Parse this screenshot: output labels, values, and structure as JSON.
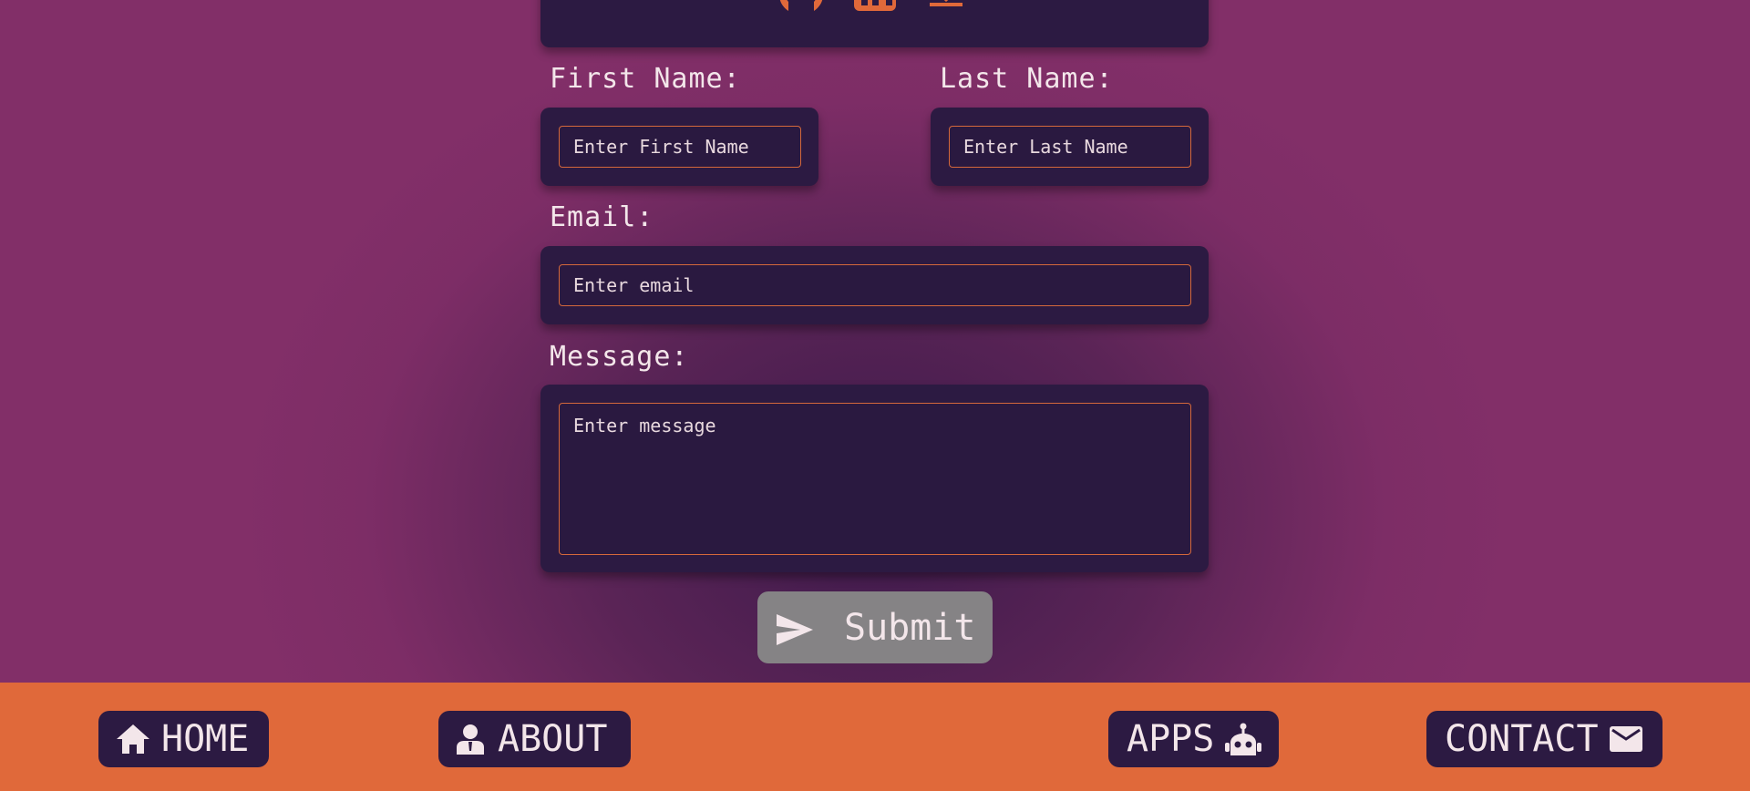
{
  "top_icons": [
    {
      "icon": "github-icon"
    },
    {
      "icon": "linkedin-icon"
    },
    {
      "icon": "download-icon"
    }
  ],
  "form": {
    "first_name": {
      "label": "First Name:",
      "placeholder": "Enter First Name"
    },
    "last_name": {
      "label": "Last Name:",
      "placeholder": "Enter Last Name"
    },
    "email": {
      "label": "Email:",
      "placeholder": "Enter email"
    },
    "message": {
      "label": "Message:",
      "placeholder": "Enter message"
    },
    "submit_label": "Submit"
  },
  "nav": {
    "home": "HOME",
    "about": "ABOUT",
    "apps": "APPS",
    "contact": "CONTACT"
  },
  "colors": {
    "accent": "#e0693a",
    "card": "#2c1a42",
    "background": "#822f68",
    "submit_disabled": "#858385"
  }
}
